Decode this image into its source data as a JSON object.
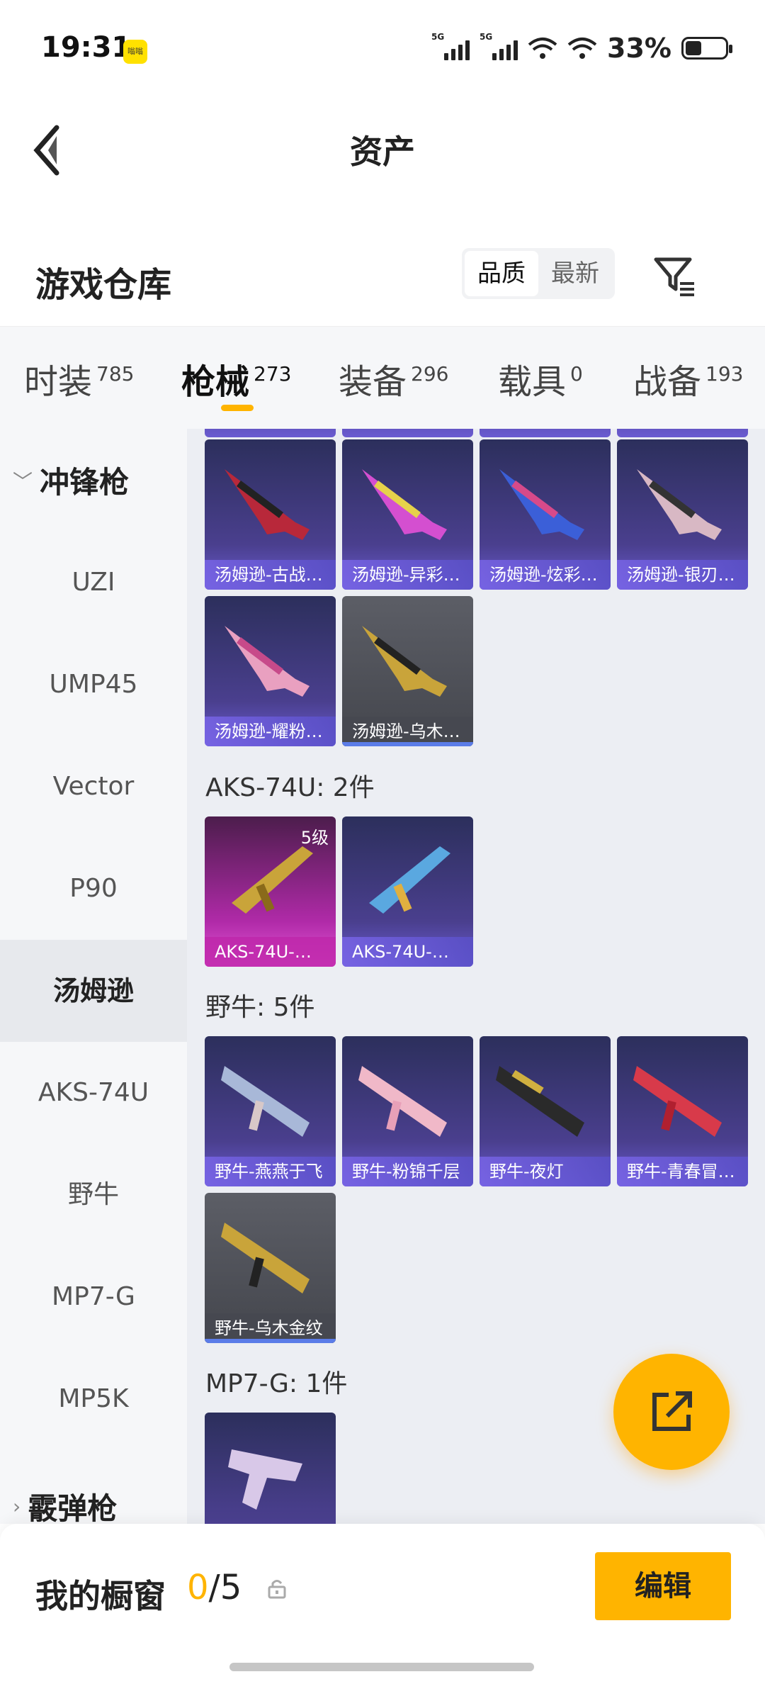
{
  "status": {
    "time": "19:31",
    "badge": "嗡嗡",
    "net1": "5G",
    "net2": "5G",
    "battery": "33%"
  },
  "header": {
    "title": "资产"
  },
  "toolbar": {
    "title": "游戏仓库",
    "sort": [
      "品质",
      "最新"
    ],
    "sort_selected": "品质"
  },
  "tabs": [
    {
      "label": "时装",
      "count": "785"
    },
    {
      "label": "枪械",
      "count": "273"
    },
    {
      "label": "装备",
      "count": "296"
    },
    {
      "label": "载具",
      "count": "0"
    },
    {
      "label": "战备",
      "count": "193"
    }
  ],
  "sidebar": {
    "category_open": "冲锋枪",
    "items": [
      "UZI",
      "UMP45",
      "Vector",
      "P90",
      "汤姆逊",
      "AKS-74U",
      "野牛",
      "MP7-G",
      "MP5K"
    ],
    "active": "汤姆逊",
    "category_closed": "霰弹枪"
  },
  "content": {
    "thompson_cards": [
      "汤姆逊-古战…",
      "汤姆逊-异彩…",
      "汤姆逊-炫彩…",
      "汤姆逊-银刃…",
      "汤姆逊-耀粉…",
      "汤姆逊-乌木…"
    ],
    "aks_title": "AKS-74U: 2件",
    "aks_cards": [
      "AKS-74U-…",
      "AKS-74U-…"
    ],
    "aks_level": "5级",
    "bison_title": "野牛: 5件",
    "bison_cards": [
      "野牛-燕燕于飞",
      "野牛-粉锦千层",
      "野牛-夜灯",
      "野牛-青春冒…",
      "野牛-乌木金纹"
    ],
    "mp7_title": "MP7-G: 1件"
  },
  "bottom": {
    "label": "我的橱窗",
    "current": "0",
    "total": "/5",
    "edit": "编辑"
  },
  "colors": {
    "accent": "#ffb400",
    "card_purple": "#4a3f8e",
    "card_gray": "#5c5e66",
    "card_pink": "#b02aa8"
  }
}
